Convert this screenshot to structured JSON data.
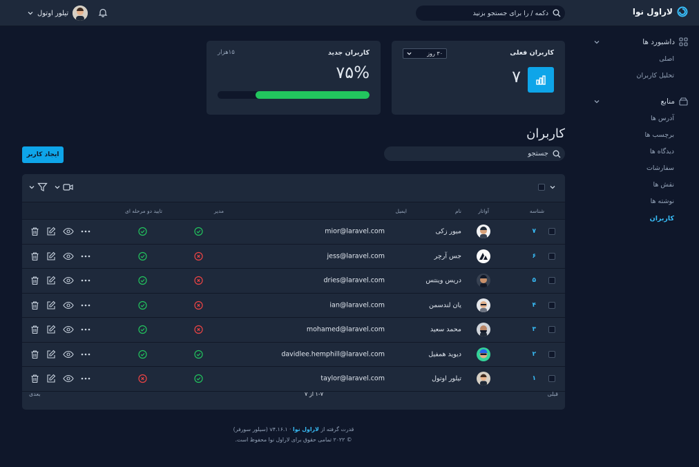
{
  "app": {
    "brand": "لاراول نوا",
    "brand_color": "#38bdf8"
  },
  "topbar": {
    "search_placeholder": "دکمه / را برای جستجو بزنید",
    "user_name": "تیلور اوتول",
    "notifications_icon": "bell-icon"
  },
  "sidebar": {
    "groups": [
      {
        "label": "داشبورد ها",
        "icon": "grid-icon",
        "items": [
          "اصلی",
          "تحلیل کاربران"
        ]
      },
      {
        "label": "منابع",
        "icon": "box-icon",
        "items": [
          "آدرس ها",
          "برچسب ها",
          "دیدگاه ها",
          "سفارشات",
          "نقش ها",
          "نوشته ها",
          "کاربران"
        ]
      }
    ],
    "active": "کاربران"
  },
  "cards": {
    "active_users": {
      "title": "کاربران فعلی",
      "range": "۳۰ روز",
      "value": "۷",
      "icon": "bar-chart-icon"
    },
    "new_users": {
      "title": "کاربران جدید",
      "subtitle": "۱۵هزار",
      "percent": "۷۵%",
      "progress": 0.75,
      "progress_color": "#22c55e"
    }
  },
  "page": {
    "title": "کاربران",
    "search_placeholder": "جستجو",
    "create_button": "ایجاد کاربر"
  },
  "table": {
    "columns": {
      "id": "شناسه",
      "avatar": "آواتار",
      "name": "نام",
      "email": "ایمیل",
      "admin": "مدیر",
      "two_factor": "تایید دو مرحله ای"
    },
    "rows": [
      {
        "id": "۷",
        "name": "میور زکی",
        "email": "mior@laravel.com",
        "admin": true,
        "two_factor": true
      },
      {
        "id": "۶",
        "name": "جس آرچر",
        "email": "jess@laravel.com",
        "admin": false,
        "two_factor": true
      },
      {
        "id": "۵",
        "name": "دریس وینتس",
        "email": "dries@laravel.com",
        "admin": false,
        "two_factor": true
      },
      {
        "id": "۴",
        "name": "یان لندسمن",
        "email": "ian@laravel.com",
        "admin": false,
        "two_factor": true
      },
      {
        "id": "۳",
        "name": "محمد سعید",
        "email": "mohamed@laravel.com",
        "admin": false,
        "two_factor": true
      },
      {
        "id": "۲",
        "name": "دیوید همفیل",
        "email": "davidlee.hemphill@laravel.com",
        "admin": true,
        "two_factor": true
      },
      {
        "id": "۱",
        "name": "تیلور اوتول",
        "email": "taylor@laravel.com",
        "admin": true,
        "two_factor": false
      }
    ],
    "pagination": {
      "previous": "قبلی",
      "status": "۱-۷ از ۷",
      "next": "بعدی"
    }
  },
  "footer": {
    "line1_prefix": "قدرت گرفته از",
    "line1_link": "لاراول نوا",
    "line1_suffix": "· v۴.۱۶.۱ (سیلور سورفر)",
    "line2": "© ۲۰۲۲ تمامی حقوق برای لاراول نوا محفوظ است."
  }
}
